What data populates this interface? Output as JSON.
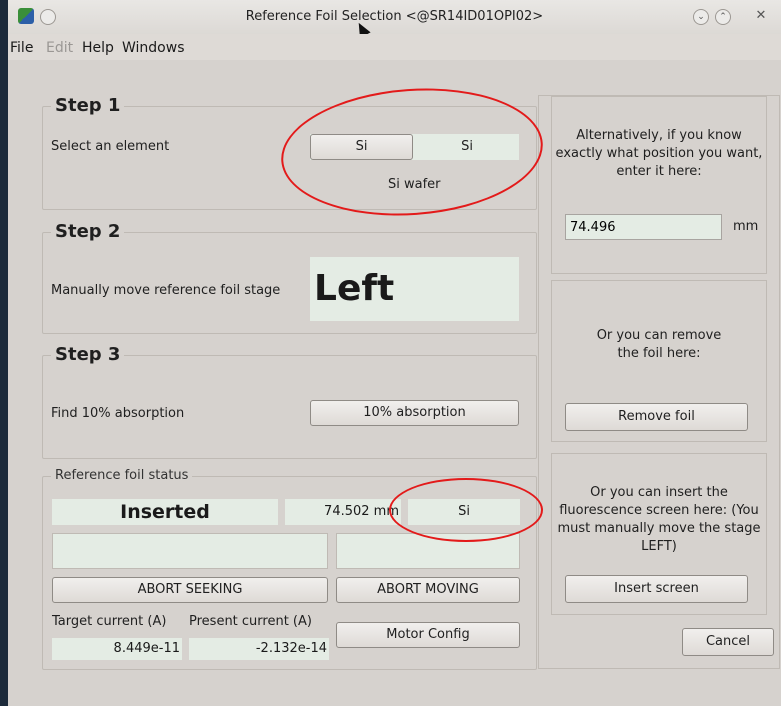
{
  "window": {
    "title": "Reference Foil Selection <@SR14ID01OPI02>"
  },
  "menu": {
    "file": "File",
    "edit": "Edit",
    "help": "Help",
    "windows": "Windows"
  },
  "step1": {
    "title": "Step 1",
    "instruction": "Select an element",
    "element_selected": "Si",
    "element_option2": "Si",
    "foil_description": "Si wafer"
  },
  "step2": {
    "title": "Step 2",
    "instruction": "Manually move reference foil stage",
    "direction": "Left"
  },
  "step3": {
    "title": "Step 3",
    "instruction": "Find 10% absorption",
    "button": "10% absorption"
  },
  "status": {
    "title": "Reference foil status",
    "state": "Inserted",
    "position": "74.502 mm",
    "element": "Si",
    "abort_seeking": "ABORT SEEKING",
    "abort_moving": "ABORT MOVING",
    "target_label": "Target current (A)",
    "present_label": "Present current (A)",
    "motor_config": "Motor Config",
    "target_current": "8.449e-11",
    "present_current": "-2.132e-14"
  },
  "right": {
    "position_text": "Alternatively, if you know exactly what position you want, enter it here:",
    "position_value": "74.496",
    "position_unit": "mm",
    "remove_text": "Or you can remove the foil here:",
    "remove_button": "Remove foil",
    "insert_text": "Or you can insert the fluorescence screen here: (You must manually move the stage LEFT)",
    "insert_button": "Insert screen",
    "cancel_button": "Cancel"
  },
  "colors": {
    "annotation": "#e31a1a",
    "field_bg": "#e4ece4",
    "window_bg": "#d6d2ce"
  }
}
